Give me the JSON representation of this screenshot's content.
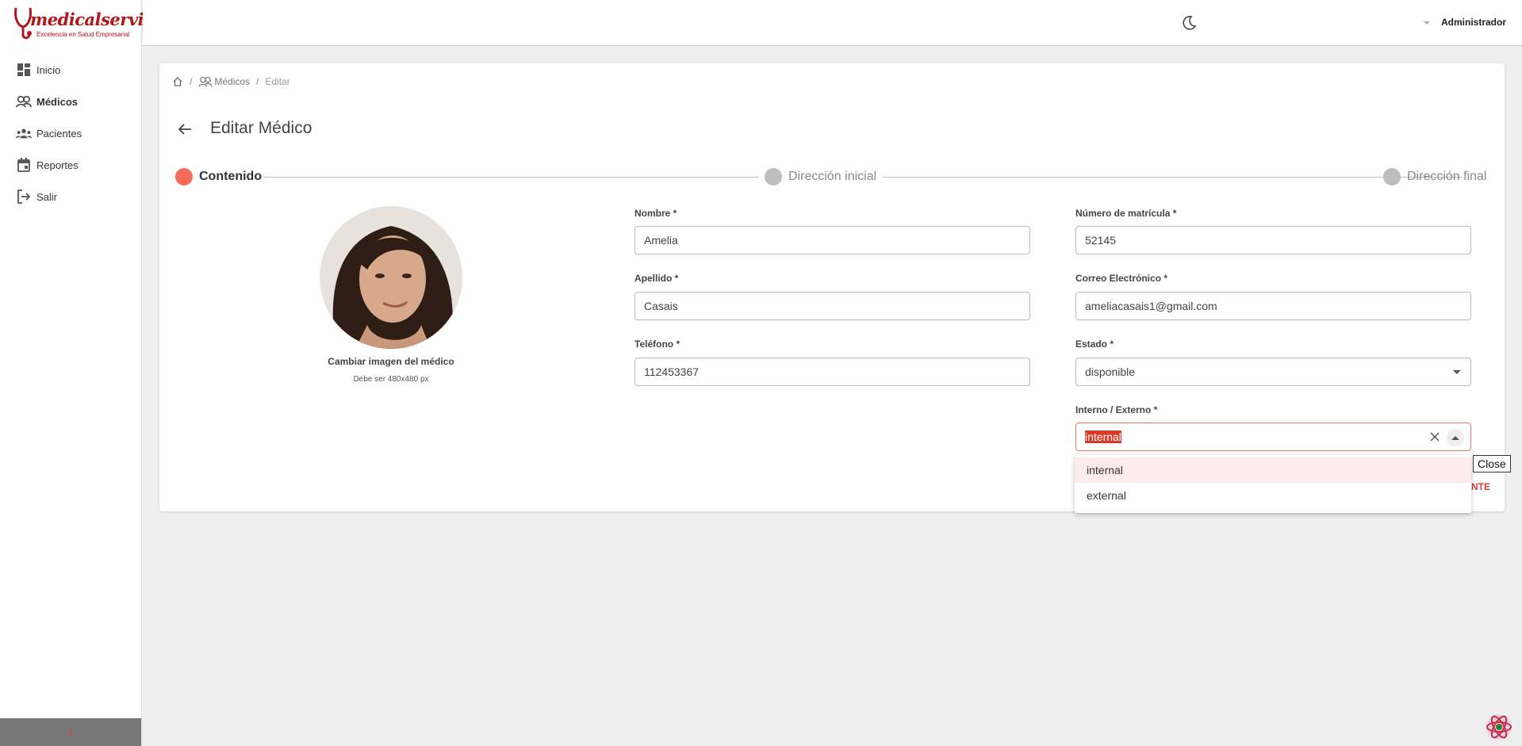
{
  "app": {
    "logo_text": "medicalservice",
    "logo_tagline": "Excelencia en Salud Empresarial"
  },
  "sidebar": {
    "items": [
      {
        "label": "Inicio",
        "icon": "dashboard-icon"
      },
      {
        "label": "Médicos",
        "icon": "doctors-icon"
      },
      {
        "label": "Pacientes",
        "icon": "patients-icon"
      },
      {
        "label": "Reportes",
        "icon": "calendar-icon"
      },
      {
        "label": "Salir",
        "icon": "logout-icon"
      }
    ],
    "collapse_glyph": "‹"
  },
  "topbar": {
    "user_name": "Administrador"
  },
  "breadcrumb": {
    "sep": "/",
    "items": [
      "Médicos",
      "Editar"
    ]
  },
  "page": {
    "title": "Editar Médico"
  },
  "stepper": {
    "steps": [
      "Contenido",
      "Dirección inicial",
      "Dirección final"
    ],
    "active_index": 0
  },
  "avatar": {
    "change_label": "Cambiar imagen del médico",
    "hint": "Debe ser 480x480 px"
  },
  "form": {
    "nombre": {
      "label": "Nombre *",
      "value": "Amelia"
    },
    "apellido": {
      "label": "Apellido *",
      "value": "Casais"
    },
    "telefono": {
      "label": "Teléfono *",
      "value": "112453367"
    },
    "matricula": {
      "label": "Número de matrícula *",
      "value": "52145"
    },
    "correo": {
      "label": "Correo Electrónico *",
      "value": "ameliacasais1@gmail.com"
    },
    "estado": {
      "label": "Estado *",
      "value": "disponible"
    },
    "interno_externo": {
      "label": "Interno / Externo *",
      "value": "internal",
      "options": [
        "internal",
        "external"
      ]
    }
  },
  "next_button": {
    "label_visible": "NTE"
  },
  "tooltip": {
    "text": "Close"
  },
  "colors": {
    "accent": "#f26b5b",
    "brand": "#b3151b",
    "step_inactive": "#bdbdbd"
  }
}
